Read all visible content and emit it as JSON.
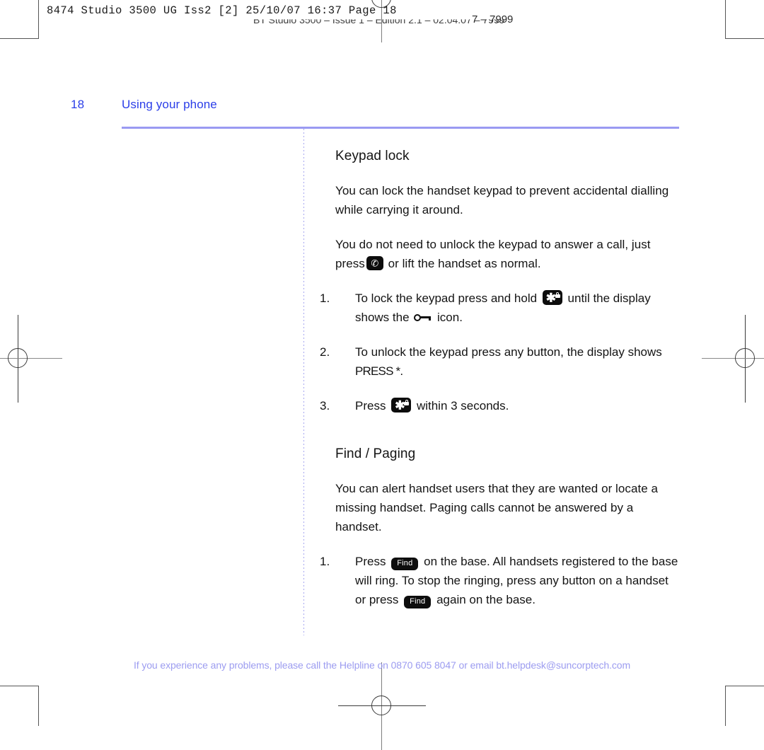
{
  "prepress": {
    "slug_main": "8474 Studio 3500 UG Iss2 [2]  25/10/07  16:37  Page 18",
    "slug_sub": "BT Studio 3500 – Issue 1 – Edition 2.1 – 02.04.07 – 7999",
    "slug_tail": "7 – 7999"
  },
  "header": {
    "page_number": "18",
    "section_title": "Using your phone"
  },
  "colors": {
    "heading_blue": "#2b3ee8",
    "rule_blue": "#9a9af2",
    "footer_blue": "#9c9cf0",
    "body_black": "#141414",
    "keycap_black": "#0d0d0d"
  },
  "content": {
    "keypad_lock": {
      "heading": "Keypad lock",
      "para_1": "You can lock the handset keypad to prevent accidental dialling while carrying it around.",
      "para_2_before": "You do not need to unlock the keypad to answer a call, just press",
      "para_2_after": "or lift the handset as normal.",
      "steps": [
        {
          "marker": "1.",
          "before": "To lock the keypad press and hold",
          "middle": "until the display shows the",
          "after": "icon."
        },
        {
          "marker": "2.",
          "before": "To unlock the keypad press any button, the display shows",
          "display": "PRESS *",
          "after": "."
        },
        {
          "marker": "3.",
          "before": "Press",
          "after": "within 3 seconds."
        }
      ]
    },
    "find_paging": {
      "heading": "Find / Paging",
      "para_1": "You can alert handset users that they are wanted or locate a missing handset. Paging calls cannot be answered by a handset.",
      "steps": [
        {
          "marker": "1.",
          "before": "Press",
          "middle": "on the base. All handsets registered to the base will ring. To stop the ringing, press any button on a handset or press",
          "after": "again on the base."
        }
      ]
    }
  },
  "icons": {
    "phone_key_label": "✆",
    "star_key_label": "✱",
    "find_button_label": "Find"
  },
  "footer": {
    "text": "If you experience any problems, please call the Helpline on 0870 605 8047 or email bt.helpdesk@suncorptech.com"
  }
}
